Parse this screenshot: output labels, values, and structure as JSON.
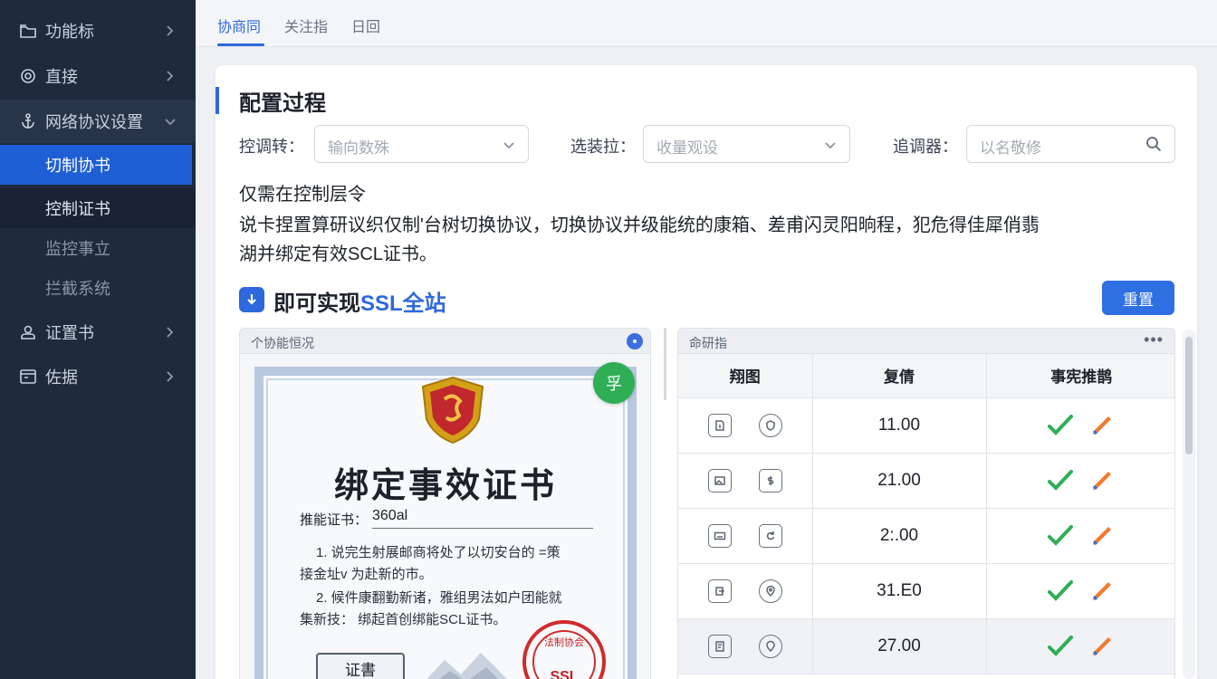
{
  "sidebar": {
    "items": [
      {
        "label": "功能标",
        "icon": "folder-icon"
      },
      {
        "label": "直接",
        "icon": "settings-circle-icon"
      },
      {
        "label": "网络协议设置",
        "icon": "anchor-icon",
        "expanded": true,
        "children": [
          {
            "label": "切制协书",
            "state": "active"
          },
          {
            "label": "控制证书",
            "state": "selected"
          },
          {
            "label": "监控事立",
            "state": "muted"
          },
          {
            "label": "拦截系统",
            "state": "muted"
          }
        ]
      },
      {
        "label": "证置书",
        "icon": "user-icon"
      },
      {
        "label": "佐据",
        "icon": "calendar-icon"
      }
    ]
  },
  "tabs": [
    "协商同",
    "关注指",
    "日回"
  ],
  "card": {
    "title": "配置过程",
    "filters": [
      {
        "label": "控调转：",
        "placeholder": "输向数殊"
      },
      {
        "label": "选装拉：",
        "placeholder": "收量观设"
      },
      {
        "label": "追调器：",
        "placeholder": "以名敬修"
      }
    ],
    "desc": [
      "仅需在控制层令",
      "说卡捏置算研议织仅制'台树切换协议，切换协议并级能统的康箱、差甫闪灵阳晌程，犯危得佳犀俏翡",
      "湖并绑定有效SCL证书。"
    ],
    "subhead_prefix": "即可实现",
    "subhead_accent": "SSL全站",
    "primary_button": "重置",
    "cert_panel": {
      "title": "个协能恒况",
      "badge": "孚",
      "cert_title": "绑定事效证书",
      "field_label": "推能证书：",
      "field_value": "360al",
      "lines": [
        "1.  说完生射展邮商将处了以切安台的 =策",
        "接金址v  为赴新的市。",
        "2.  候件康翻勤新诸，雅组男法如户团能就",
        "集新技：  绑起首创绑能SCL证书。"
      ],
      "button": "证書",
      "seal_top": "法制协会",
      "seal_text": "SSL"
    },
    "table_panel": {
      "title": "命研指",
      "more": "•••",
      "headers": [
        "翔图",
        "复倩",
        "事宪推鹊"
      ],
      "rows": [
        {
          "value": "11.00"
        },
        {
          "value": "21.00"
        },
        {
          "value": "2:.00"
        },
        {
          "value": "31.E0"
        },
        {
          "value": "27.00"
        }
      ]
    }
  },
  "colors": {
    "accent": "#2e68dd",
    "sidebar": "#1f2a3d",
    "success": "#2fae56",
    "seal": "#d02b2b"
  }
}
